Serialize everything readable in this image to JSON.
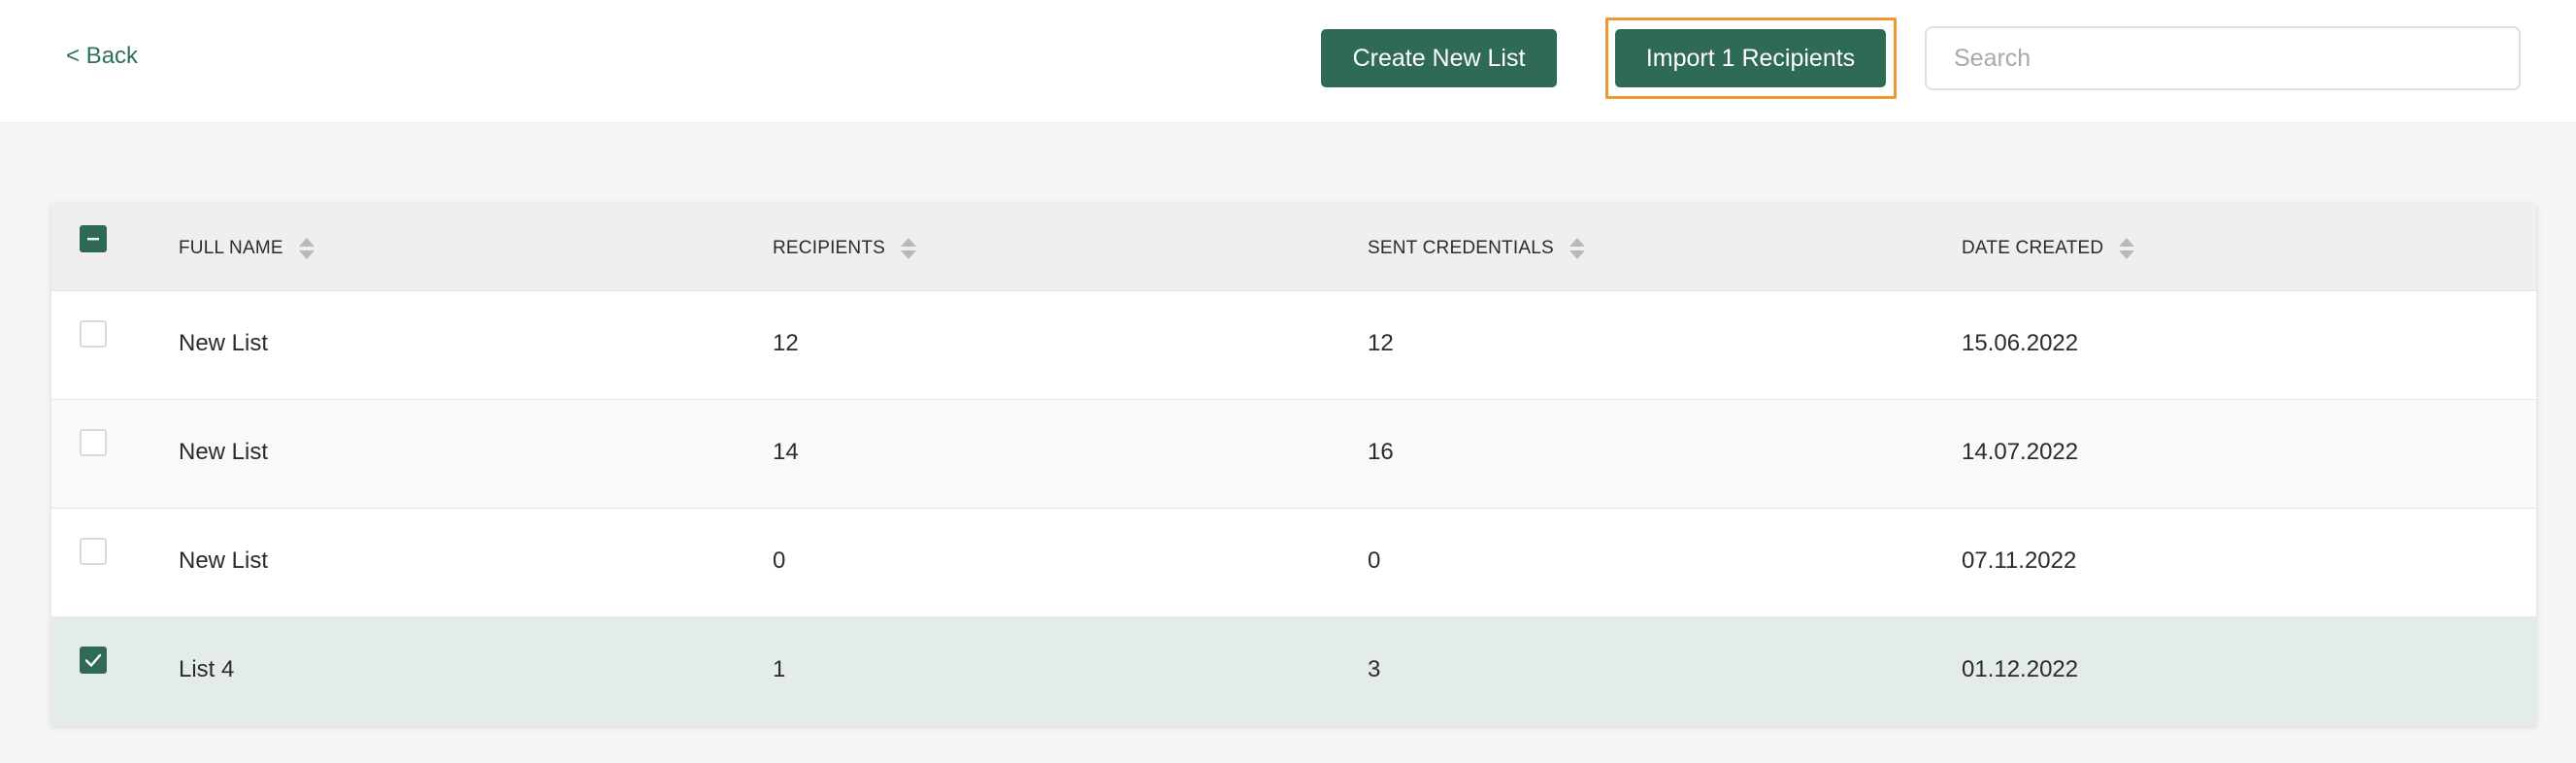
{
  "header": {
    "back_label": "< Back",
    "create_button": "Create New List",
    "import_button": "Import 1 Recipients",
    "search_placeholder": "Search",
    "search_value": ""
  },
  "table": {
    "columns": [
      "FULL NAME",
      "RECIPIENTS",
      "SENT CREDENTIALS",
      "DATE CREATED"
    ],
    "select_all_state": "indeterminate",
    "rows": [
      {
        "selected": false,
        "name": "New List",
        "recipients": "12",
        "sent_credentials": "12",
        "date_created": "15.06.2022"
      },
      {
        "selected": false,
        "name": "New List",
        "recipients": "14",
        "sent_credentials": "16",
        "date_created": "14.07.2022"
      },
      {
        "selected": false,
        "name": "New List",
        "recipients": "0",
        "sent_credentials": "0",
        "date_created": "07.11.2022"
      },
      {
        "selected": true,
        "name": "List 4",
        "recipients": "1",
        "sent_credentials": "3",
        "date_created": "01.12.2022"
      }
    ]
  },
  "icons": {
    "sort": "sort-icon",
    "checkbox_checked": "checkmark-icon",
    "checkbox_indeterminate": "minus-icon"
  },
  "colors": {
    "primary": "#2f6a58",
    "highlight": "#f0952f",
    "selected_row": "#e4ecea"
  }
}
